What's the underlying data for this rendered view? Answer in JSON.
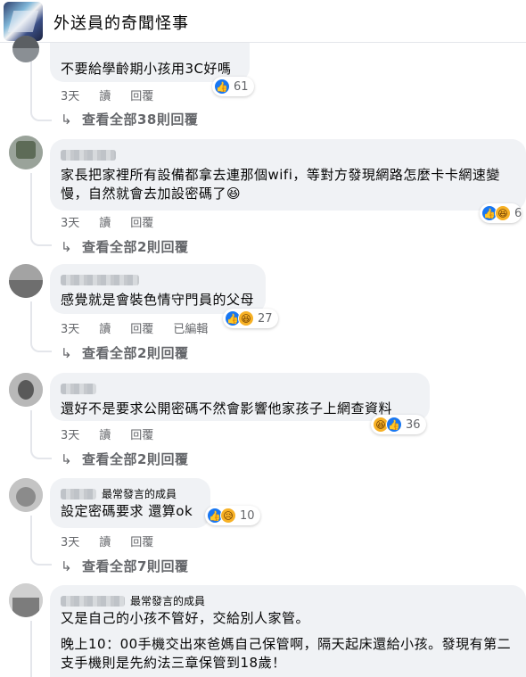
{
  "group": {
    "title": "外送員的奇聞怪事"
  },
  "comments": [
    {
      "text": "不要給學齡期小孩用3C好嗎",
      "reaction_count": "61",
      "time": "3天",
      "read": "讀",
      "reply": "回覆",
      "view_replies": "查看全部38則回覆"
    },
    {
      "text": "家長把家裡所有設備都拿去連那個wifi，等對方發現網路怎麼卡卡網速變慢，自然就會去加設密碼了😆",
      "reaction_count": "6",
      "time": "3天",
      "read": "讀",
      "reply": "回覆",
      "view_replies": "查看全部2則回覆"
    },
    {
      "text": "感覺就是會裝色情守門員的父母",
      "reaction_count": "27",
      "time": "3天",
      "read": "讀",
      "reply": "回覆",
      "edited": "已編輯",
      "view_replies": "查看全部2則回覆"
    },
    {
      "text": "還好不是要求公開密碼不然會影響他家孩子上網查資料",
      "reaction_count": "36",
      "time": "3天",
      "read": "讀",
      "reply": "回覆",
      "view_replies": "查看全部2則回覆"
    },
    {
      "badge": "最常發言的成員",
      "text": "設定密碼要求 還算ok",
      "reaction_count": "10",
      "time": "3天",
      "read": "讀",
      "reply": "回覆",
      "view_replies": "查看全部7則回覆"
    },
    {
      "badge": "最常發言的成員",
      "text1": "又是自己的小孩不管好，交給別人家管。",
      "text2": "晚上10：00手機交出來爸媽自己保管啊，隔天起床還給小孩。發現有第二支手機則是先約法三章保管到18歲！"
    }
  ],
  "icons": {
    "like": "like-icon",
    "haha": "haha-icon",
    "sad": "sad-icon",
    "reply_arrow": "reply-arrow-icon"
  },
  "colors": {
    "like": "#1877f2",
    "emoji": "#f7b125",
    "meta": "#65676b",
    "bubble": "#f0f2f5"
  }
}
